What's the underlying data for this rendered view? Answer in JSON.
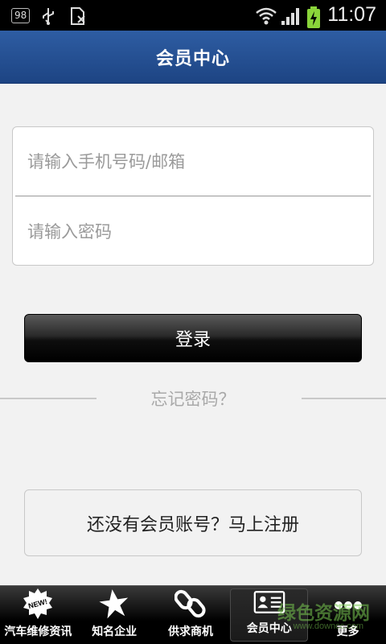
{
  "status_bar": {
    "badge": "98",
    "time": "11:07"
  },
  "header": {
    "title": "会员中心"
  },
  "form": {
    "account_placeholder": "请输入手机号码/邮箱",
    "password_placeholder": "请输入密码"
  },
  "actions": {
    "login_label": "登录",
    "forgot_label": "忘记密码？",
    "register_label": "还没有会员账号？马上注册"
  },
  "tabs": [
    {
      "label": "汽车维修资讯",
      "icon": "new-badge-icon"
    },
    {
      "label": "知名企业",
      "icon": "star-icon"
    },
    {
      "label": "供求商机",
      "icon": "chain-link-icon"
    },
    {
      "label": "会员中心",
      "icon": "member-card-icon",
      "active": true
    },
    {
      "label": "更多",
      "icon": "more-dots-icon"
    }
  ],
  "watermark": {
    "text": "绿色资源网",
    "sub": "www.downcc.com"
  },
  "colors": {
    "header_top": "#2e5da3",
    "header_bottom": "#1d4483",
    "background": "#f2f2f2",
    "battery": "#8ad43a"
  }
}
